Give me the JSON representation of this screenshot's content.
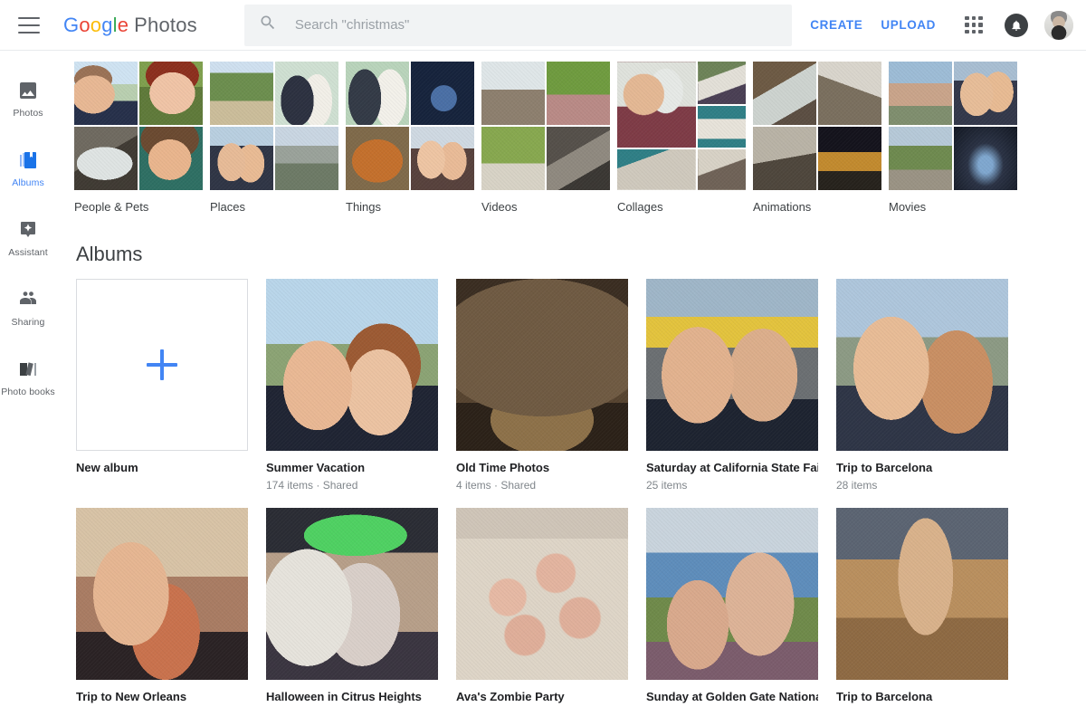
{
  "header": {
    "menu_icon": "hamburger-menu-icon",
    "brand_google": "Google",
    "brand_product": "Photos",
    "search_icon": "search-icon",
    "search_value": "",
    "search_placeholder": "Search \"christmas\"",
    "create_label": "CREATE",
    "upload_label": "UPLOAD",
    "apps_icon": "apps-grid-icon",
    "bell_icon": "notification-bell-icon",
    "avatar": "user-avatar",
    "accent_color": "#4285f4"
  },
  "sidebar": {
    "items": [
      {
        "label": "Photos",
        "icon": "photo-icon",
        "active": false
      },
      {
        "label": "Albums",
        "icon": "albums-icon",
        "active": true
      },
      {
        "label": "Assistant",
        "icon": "assistant-icon",
        "active": false
      },
      {
        "label": "Sharing",
        "icon": "sharing-icon",
        "active": false
      },
      {
        "label": "Photo books",
        "icon": "photobook-icon",
        "active": false
      }
    ]
  },
  "categories": [
    {
      "label": "People & Pets",
      "tiles": [
        "p-man1",
        "p-woman1",
        "p-cat1",
        "p-girl1"
      ]
    },
    {
      "label": "Places",
      "tiles": [
        "p-tree",
        "p-wedding",
        "p-couple",
        "p-houses"
      ]
    },
    {
      "label": "Things",
      "tiles": [
        "p-wed2",
        "p-space",
        "p-orangecat",
        "p-twowomen"
      ]
    },
    {
      "label": "Videos",
      "tiles": [
        "p-kitchen",
        "p-grass",
        "p-yard",
        "p-catbars"
      ]
    },
    {
      "label": "Collages",
      "tiles": [
        "p-collman",
        "p-catbed",
        "p-catlegs",
        "p-catsleep",
        "p-dogs"
      ],
      "layout": "collage"
    },
    {
      "label": "Animations",
      "tiles": [
        "p-animcat",
        "p-animcat2",
        "p-animcat3",
        "p-night"
      ]
    },
    {
      "label": "Movies",
      "tiles": [
        "p-beach",
        "p-selfie",
        "p-park",
        "p-citynight"
      ]
    }
  ],
  "albums_section": {
    "title": "Albums",
    "new_album": {
      "label": "New album",
      "icon": "plus-icon"
    },
    "items": [
      {
        "title": "Summer Vacation",
        "meta": "174 items  ·  Shared",
        "thumb": "p-summer"
      },
      {
        "title": "Old Time Photos",
        "meta": "4 items  ·  Shared",
        "thumb": "p-oldtime"
      },
      {
        "title": "Saturday at California State Fair",
        "meta": "25 items",
        "thumb": "p-fair"
      },
      {
        "title": "Trip to Barcelona",
        "meta": "28 items",
        "thumb": "p-barcelona1"
      },
      {
        "title": "Trip to New Orleans",
        "meta": "",
        "thumb": "p-neworleans"
      },
      {
        "title": "Halloween in Citrus Heights",
        "meta": "",
        "thumb": "p-halloween"
      },
      {
        "title": "Ava's Zombie Party",
        "meta": "",
        "thumb": "p-zombie"
      },
      {
        "title": "Sunday at Golden Gate National",
        "meta": "",
        "thumb": "p-goldengate"
      },
      {
        "title": "Trip to Barcelona",
        "meta": "",
        "thumb": "p-barcelona2"
      }
    ]
  }
}
